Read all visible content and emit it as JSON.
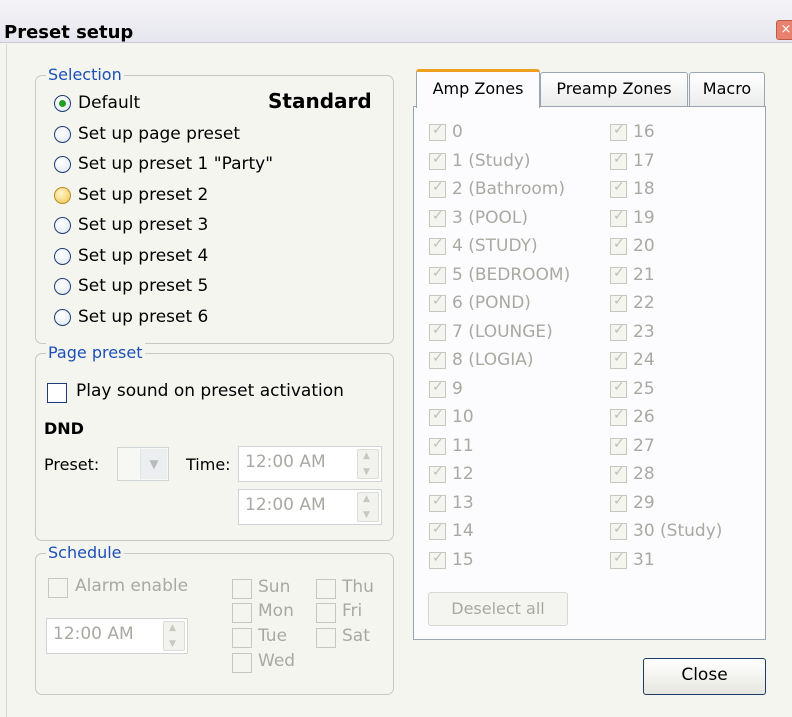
{
  "window": {
    "title": "Preset setup",
    "close_glyph": "×"
  },
  "selection": {
    "legend": "Selection",
    "mode_label": "Standard",
    "options": [
      {
        "label": "Default",
        "state": "selected"
      },
      {
        "label": "Set up page preset",
        "state": "normal"
      },
      {
        "label": "Set up preset 1 \"Party\"",
        "state": "normal"
      },
      {
        "label": "Set up preset 2",
        "state": "hover"
      },
      {
        "label": "Set up preset 3",
        "state": "normal"
      },
      {
        "label": "Set up preset 4",
        "state": "normal"
      },
      {
        "label": "Set up preset 5",
        "state": "normal"
      },
      {
        "label": "Set up preset 6",
        "state": "normal"
      }
    ]
  },
  "page_preset": {
    "legend": "Page preset",
    "play_sound_label": "Play sound on preset activation",
    "dnd_label": "DND",
    "preset_label": "Preset:",
    "time_label": "Time:",
    "time_start": "12:00 AM",
    "time_end": "12:00 AM",
    "dropdown_icon": "chevron-down-icon"
  },
  "schedule": {
    "legend": "Schedule",
    "alarm_label": "Alarm enable",
    "alarm_time": "12:00 AM",
    "days": [
      "Sun",
      "Mon",
      "Tue",
      "Wed",
      "Thu",
      "Fri",
      "Sat"
    ]
  },
  "tabs": [
    {
      "label": "Amp Zones",
      "active": true
    },
    {
      "label": "Preamp Zones",
      "active": false
    },
    {
      "label": "Macro",
      "active": false
    }
  ],
  "zones": [
    "0",
    "1 (Study)",
    "2 (Bathroom)",
    "3 (POOL)",
    "4 (STUDY)",
    "5 (BEDROOM)",
    "6 (POND)",
    "7 (LOUNGE)",
    "8 (LOGIA)",
    "9",
    "10",
    "11",
    "12",
    "13",
    "14",
    "15",
    "16",
    "17",
    "18",
    "19",
    "20",
    "21",
    "22",
    "23",
    "24",
    "25",
    "26",
    "27",
    "28",
    "29",
    "30 (Study)",
    "31"
  ],
  "buttons": {
    "deselect_all": "Deselect all",
    "close": "Close"
  },
  "colors": {
    "legend_text": "#1c4fb8",
    "tab_accent": "#f0a020",
    "radio_selected": "#21a121",
    "disabled_text": "#a9a9a2"
  }
}
